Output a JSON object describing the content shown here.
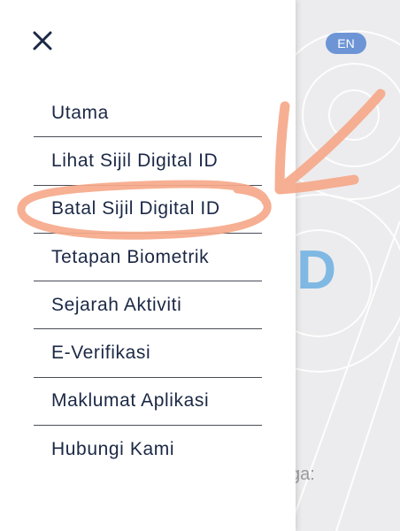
{
  "language_toggle": {
    "label": "EN"
  },
  "background": {
    "logo_text": "ID",
    "partial_text": "ga:"
  },
  "drawer": {
    "close_icon": "close-icon",
    "items": [
      {
        "label": "Utama"
      },
      {
        "label": "Lihat Sijil Digital ID"
      },
      {
        "label": "Batal Sijil Digital ID"
      },
      {
        "label": "Tetapan Biometrik"
      },
      {
        "label": "Sejarah Aktiviti"
      },
      {
        "label": "E-Verifikasi"
      },
      {
        "label": "Maklumat Aplikasi"
      },
      {
        "label": "Hubungi Kami"
      }
    ]
  },
  "colors": {
    "menu_text": "#1b2845",
    "divider": "#4a4d57",
    "accent_pill": "#6d95d6",
    "annotation": "#f6a98a"
  }
}
